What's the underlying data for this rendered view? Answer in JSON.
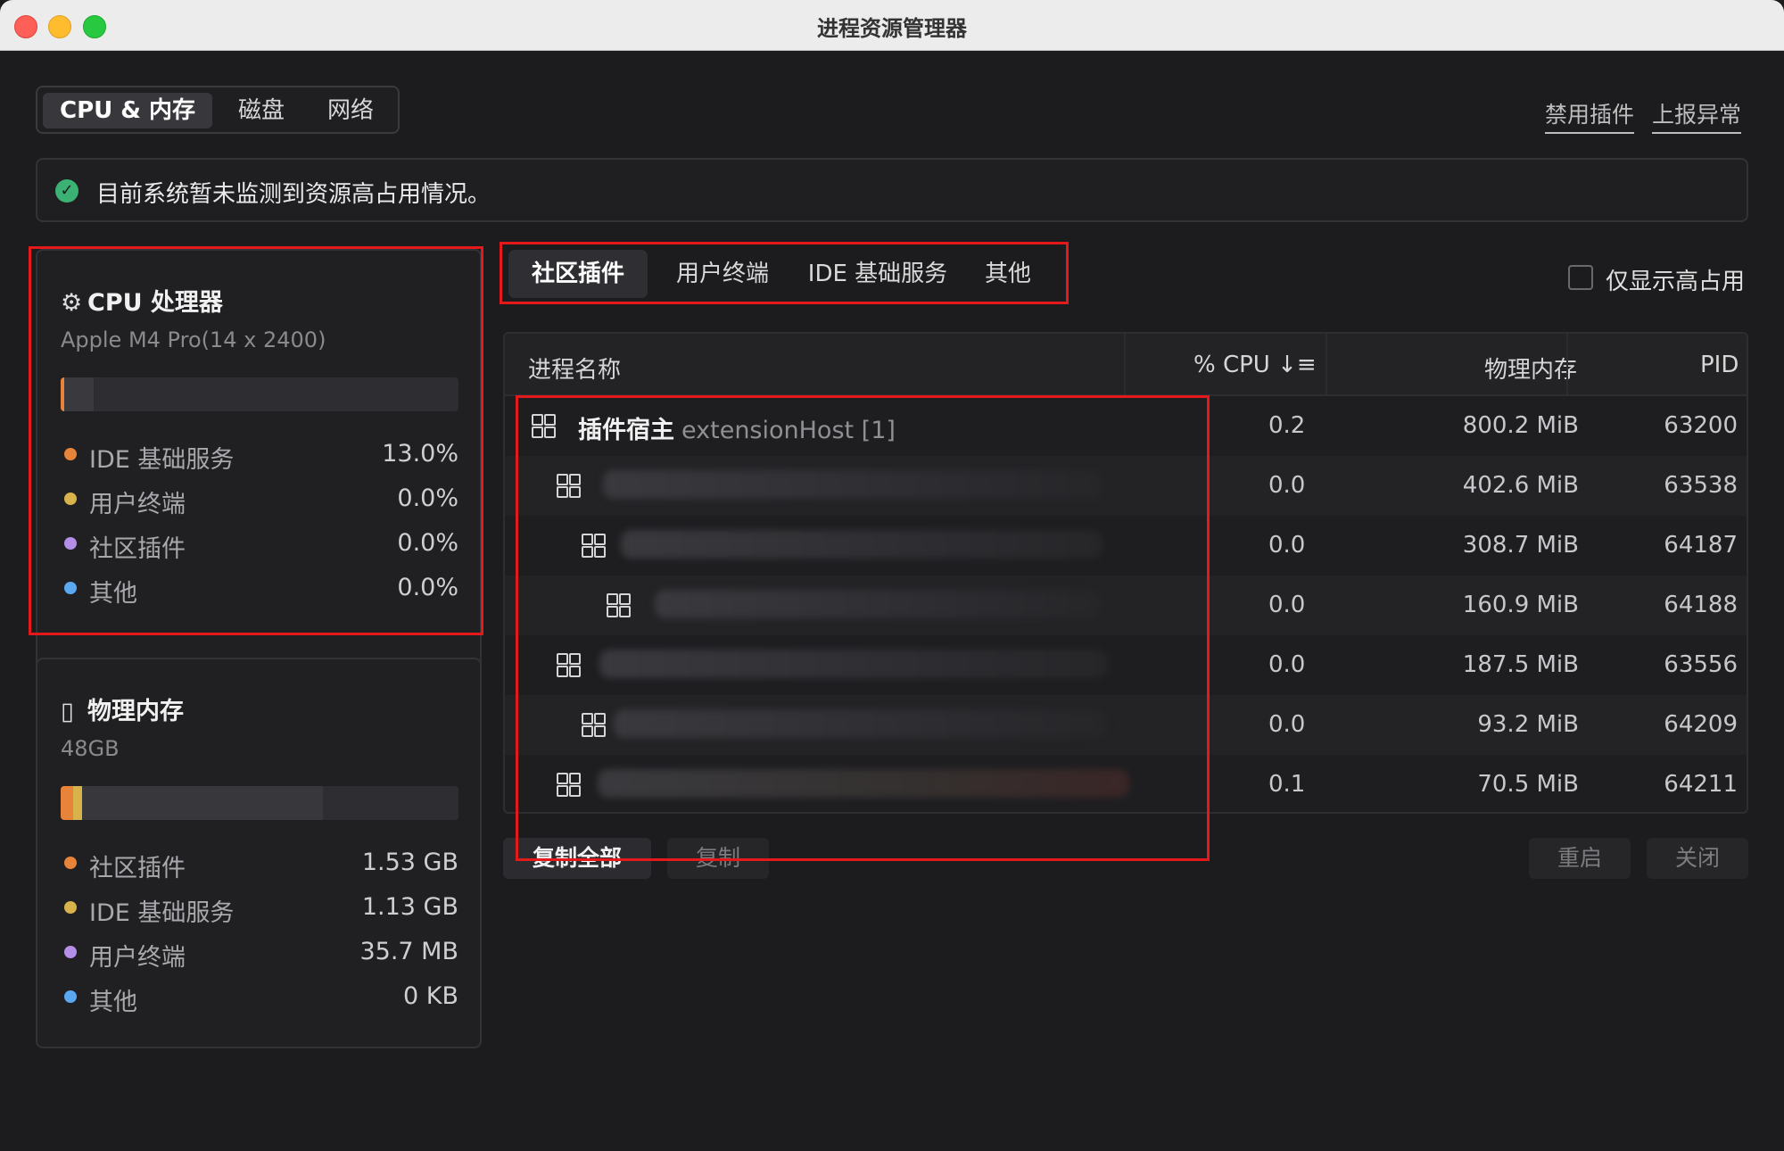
{
  "window": {
    "title": "进程资源管理器"
  },
  "top_tabs": [
    {
      "label": "CPU & 内存",
      "active": true
    },
    {
      "label": "磁盘",
      "active": false
    },
    {
      "label": "网络",
      "active": false
    }
  ],
  "links": {
    "disable_plugins": "禁用插件",
    "report_issue": "上报异常"
  },
  "banner": {
    "text": "目前系统暂未监测到资源高占用情况。"
  },
  "cpu_card": {
    "title": "CPU 处理器",
    "icon": "cpu-chip-icon",
    "subtitle": "Apple M4 Pro(14 x 2400)",
    "usage_fraction": 0.08,
    "items": [
      {
        "label": "IDE 基础服务",
        "value": "13.0%",
        "color": "#e8833a"
      },
      {
        "label": "用户终端",
        "value": "0.0%",
        "color": "#d8b24a"
      },
      {
        "label": "社区插件",
        "value": "0.0%",
        "color": "#b58ee8"
      },
      {
        "label": "其他",
        "value": "0.0%",
        "color": "#5aa9f0"
      }
    ]
  },
  "mem_card": {
    "title": "物理内存",
    "icon": "memory-card-icon",
    "subtitle": "48GB",
    "usage_fraction": 0.66,
    "items": [
      {
        "label": "社区插件",
        "value": "1.53 GB",
        "color": "#e8833a"
      },
      {
        "label": "IDE 基础服务",
        "value": "1.13 GB",
        "color": "#d8b24a"
      },
      {
        "label": "用户终端",
        "value": "35.7 MB",
        "color": "#b58ee8"
      },
      {
        "label": "其他",
        "value": "0 KB",
        "color": "#5aa9f0"
      }
    ]
  },
  "process_tabs": [
    {
      "label": "社区插件",
      "active": true
    },
    {
      "label": "用户终端",
      "active": false
    },
    {
      "label": "IDE 基础服务",
      "active": false
    },
    {
      "label": "其他",
      "active": false
    }
  ],
  "filter": {
    "only_high_label": "仅显示高占用",
    "checked": false
  },
  "table": {
    "columns": {
      "name": "进程名称",
      "cpu": "% CPU ↓≡",
      "memory": "物理内存",
      "pid": "PID"
    },
    "rows": [
      {
        "indent": 0,
        "name": "插件宿主",
        "name_sub": "extensionHost [1]",
        "cpu": "0.2",
        "memory": "800.2 MiB",
        "pid": "63200"
      },
      {
        "indent": 1,
        "name": "",
        "name_sub": "",
        "cpu": "0.0",
        "memory": "402.6 MiB",
        "pid": "63538"
      },
      {
        "indent": 2,
        "name": "",
        "name_sub": "",
        "cpu": "0.0",
        "memory": "308.7 MiB",
        "pid": "64187"
      },
      {
        "indent": 3,
        "name": "",
        "name_sub": "",
        "cpu": "0.0",
        "memory": "160.9 MiB",
        "pid": "64188"
      },
      {
        "indent": 1,
        "name": "",
        "name_sub": "",
        "cpu": "0.0",
        "memory": "187.5 MiB",
        "pid": "63556"
      },
      {
        "indent": 2,
        "name": "",
        "name_sub": "",
        "cpu": "0.0",
        "memory": "93.2 MiB",
        "pid": "64209"
      },
      {
        "indent": 1,
        "name": "",
        "name_sub": "",
        "cpu": "0.1",
        "memory": "70.5 MiB",
        "pid": "64211"
      }
    ]
  },
  "actions": {
    "copy_all": "复制全部",
    "copy": "复制",
    "restart": "重启",
    "close": "关闭"
  }
}
